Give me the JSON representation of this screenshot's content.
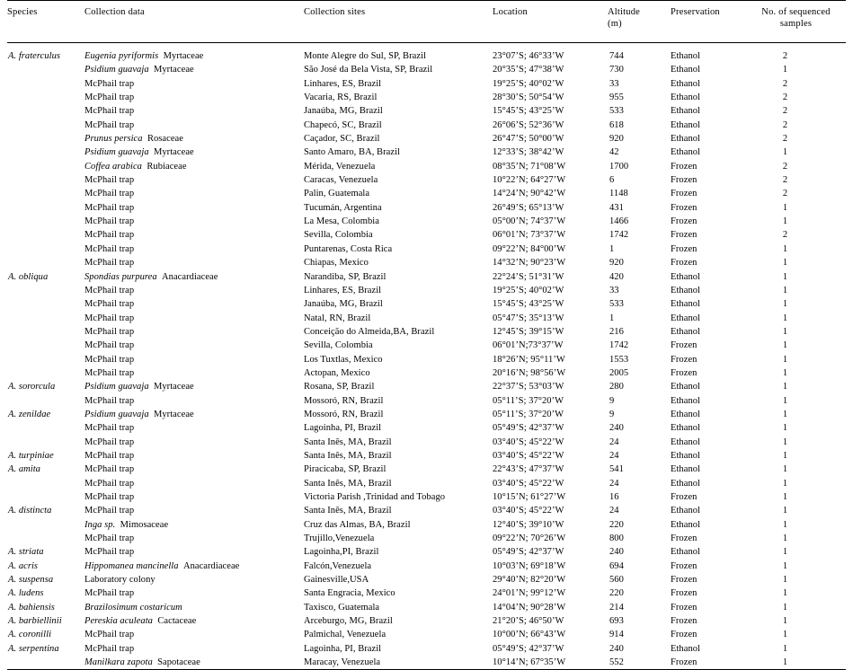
{
  "table": {
    "columns": [
      {
        "key": "species",
        "label": "Species"
      },
      {
        "key": "collection",
        "label": "Collection data"
      },
      {
        "key": "sites",
        "label": "Collection  sites"
      },
      {
        "key": "location",
        "label": "Location"
      },
      {
        "key": "altitude",
        "label": "Altitude",
        "label2": "(m)"
      },
      {
        "key": "preservation",
        "label": "Preservation"
      },
      {
        "key": "samples",
        "label": "No. of sequenced",
        "label2": "samples"
      }
    ],
    "rows": [
      {
        "species": "A. fraterculus",
        "collection_sci": "Eugenia pyriformis",
        "collection_fam": "Myrtaceae",
        "sites": "Monte Alegre do Sul, SP, Brazil",
        "location": "23°07’S; 46°33’W",
        "altitude": "744",
        "preservation": "Ethanol",
        "samples": "2"
      },
      {
        "species": "",
        "collection_sci": "Psidium guavaja",
        "collection_fam": "Myrtaceae",
        "sites": "São José da Bela Vista, SP, Brazil",
        "location": "20°35’S; 47°38’W",
        "altitude": "730",
        "preservation": "Ethanol",
        "samples": "1"
      },
      {
        "species": "",
        "collection_sci": "",
        "collection_fam": "McPhail trap",
        "sites": "Linhares, ES, Brazil",
        "location": "19°25’S; 40°02’W",
        "altitude": "33",
        "preservation": "Ethanol",
        "samples": "2"
      },
      {
        "species": "",
        "collection_sci": "",
        "collection_fam": "McPhail trap",
        "sites": "Vacaria, RS, Brazil",
        "location": "28°30’S; 50°54’W",
        "altitude": "955",
        "preservation": "Ethanol",
        "samples": "2"
      },
      {
        "species": "",
        "collection_sci": "",
        "collection_fam": "McPhail trap",
        "sites": "Janaúba, MG, Brazil",
        "location": "15°45’S; 43°25’W",
        "altitude": "533",
        "preservation": "Ethanol",
        "samples": "2"
      },
      {
        "species": "",
        "collection_sci": "",
        "collection_fam": "McPhail trap",
        "sites": "Chapecó, SC, Brazil",
        "location": "26°06’S; 52°36’W",
        "altitude": "618",
        "preservation": "Ethanol",
        "samples": "2"
      },
      {
        "species": "",
        "collection_sci": "Prunus persica",
        "collection_fam": "Rosaceae",
        "sites": "Caçador, SC, Brazil",
        "location": "26°47’S; 50°00’W",
        "altitude": "920",
        "preservation": "Ethanol",
        "samples": "2"
      },
      {
        "species": "",
        "collection_sci": "Psidium guavaja",
        "collection_fam": "Myrtaceae",
        "sites": "Santo Amaro, BA, Brazil",
        "location": "12°33’S; 38°42’W",
        "altitude": "42",
        "preservation": "Ethanol",
        "samples": "1"
      },
      {
        "species": "",
        "collection_sci": "Coffea arabica",
        "collection_fam": "Rubiaceae",
        "sites": "Mérida, Venezuela",
        "location": "08°35’N; 71°08’W",
        "altitude": "1700",
        "preservation": "Frozen",
        "samples": "2"
      },
      {
        "species": "",
        "collection_sci": "",
        "collection_fam": "McPhail trap",
        "sites": "Caracas, Venezuela",
        "location": "10°22’N; 64°27’W",
        "altitude": "6",
        "preservation": "Frozen",
        "samples": "2"
      },
      {
        "species": "",
        "collection_sci": "",
        "collection_fam": "McPhail trap",
        "sites": "Palin, Guatemala",
        "location": "14°24’N; 90°42’W",
        "altitude": "1148",
        "preservation": "Frozen",
        "samples": "2"
      },
      {
        "species": "",
        "collection_sci": "",
        "collection_fam": "McPhail trap",
        "sites": "Tucumán, Argentina",
        "location": "26°49’S; 65°13’W",
        "altitude": "431",
        "preservation": "Frozen",
        "samples": "1"
      },
      {
        "species": "",
        "collection_sci": "",
        "collection_fam": "McPhail trap",
        "sites": "La Mesa, Colombia",
        "location": "05°00’N; 74°37’W",
        "altitude": "1466",
        "preservation": "Frozen",
        "samples": "1"
      },
      {
        "species": "",
        "collection_sci": "",
        "collection_fam": "McPhail trap",
        "sites": "Sevilla, Colombia",
        "location": "06°01’N; 73°37’W",
        "altitude": "1742",
        "preservation": "Frozen",
        "samples": "2"
      },
      {
        "species": "",
        "collection_sci": "",
        "collection_fam": "McPhail trap",
        "sites": "Puntarenas, Costa Rica",
        "location": "09°22’N; 84°00’W",
        "altitude": "1",
        "preservation": "Frozen",
        "samples": "1"
      },
      {
        "species": "",
        "collection_sci": "",
        "collection_fam": "McPhail trap",
        "sites": "Chiapas, Mexico",
        "location": "14°32’N; 90°23’W",
        "altitude": "920",
        "preservation": "Frozen",
        "samples": "1"
      },
      {
        "species": "A. obliqua",
        "collection_sci": "Spondias purpurea",
        "collection_fam": "Anacardiaceae",
        "sites": "Narandiba, SP, Brazil",
        "location": "22°24’S; 51°31’W",
        "altitude": "420",
        "preservation": "Ethanol",
        "samples": "1"
      },
      {
        "species": "",
        "collection_sci": "",
        "collection_fam": "McPhail trap",
        "sites": "Linhares, ES, Brazil",
        "location": "19°25’S; 40°02’W",
        "altitude": "33",
        "preservation": "Ethanol",
        "samples": "1"
      },
      {
        "species": "",
        "collection_sci": "",
        "collection_fam": "McPhail trap",
        "sites": "Janaúba, MG, Brazil",
        "location": "15°45’S; 43°25’W",
        "altitude": "533",
        "preservation": "Ethanol",
        "samples": "1"
      },
      {
        "species": "",
        "collection_sci": "",
        "collection_fam": "McPhail trap",
        "sites": "Natal, RN, Brazil",
        "location": "05°47’S; 35°13’W",
        "altitude": "1",
        "preservation": "Ethanol",
        "samples": "1"
      },
      {
        "species": "",
        "collection_sci": "",
        "collection_fam": "McPhail trap",
        "sites": "Conceição do Almeida,BA, Brazil",
        "location": "12°45’S; 39°15’W",
        "altitude": "216",
        "preservation": "Ethanol",
        "samples": "1"
      },
      {
        "species": "",
        "collection_sci": "",
        "collection_fam": "McPhail trap",
        "sites": "Sevilla, Colombia",
        "location": "06°01’N;73°37’W",
        "altitude": "1742",
        "preservation": "Frozen",
        "samples": "1"
      },
      {
        "species": "",
        "collection_sci": "",
        "collection_fam": "McPhail trap",
        "sites": "Los Tuxtlas, Mexico",
        "location": "18°26’N; 95°11’W",
        "altitude": "1553",
        "preservation": "Frozen",
        "samples": "1"
      },
      {
        "species": "",
        "collection_sci": "",
        "collection_fam": "McPhail trap",
        "sites": "Actopan, Mexico",
        "location": "20°16’N; 98°56’W",
        "altitude": "2005",
        "preservation": "Frozen",
        "samples": "1"
      },
      {
        "species": "A. sororcula",
        "collection_sci": "Psidium guavaja",
        "collection_fam": "Myrtaceae",
        "sites": "Rosana, SP, Brazil",
        "location": "22°37’S; 53°03’W",
        "altitude": "280",
        "preservation": "Ethanol",
        "samples": "1"
      },
      {
        "species": "",
        "collection_sci": "",
        "collection_fam": "McPhail trap",
        "sites": "Mossoró, RN, Brazil",
        "location": "05°11’S; 37°20’W",
        "altitude": "9",
        "preservation": "Ethanol",
        "samples": "1"
      },
      {
        "species": "A. zenildae",
        "collection_sci": "Psidium guavaja",
        "collection_fam": "Myrtaceae",
        "sites": "Mossoró, RN, Brazil",
        "location": "05°11’S; 37°20’W",
        "altitude": "9",
        "preservation": "Ethanol",
        "samples": "1"
      },
      {
        "species": "",
        "collection_sci": "",
        "collection_fam": "McPhail trap",
        "sites": "Lagoinha, PI, Brazil",
        "location": "05°49’S; 42°37’W",
        "altitude": "240",
        "preservation": "Ethanol",
        "samples": "1"
      },
      {
        "species": "",
        "collection_sci": "",
        "collection_fam": "McPhail trap",
        "sites": "Santa Inês, MA, Brazil",
        "location": "03°40’S; 45°22’W",
        "altitude": "24",
        "preservation": "Ethanol",
        "samples": "1"
      },
      {
        "species": "A. turpiniae",
        "collection_sci": "",
        "collection_fam": "McPhail trap",
        "sites": "Santa Inês, MA, Brazil",
        "location": "03°40’S; 45°22’W",
        "altitude": "24",
        "preservation": "Ethanol",
        "samples": "1"
      },
      {
        "species": "A. amita",
        "collection_sci": "",
        "collection_fam": "McPhail trap",
        "sites": "Piracicaba, SP, Brazil",
        "location": "22°43’S; 47°37’W",
        "altitude": "541",
        "preservation": "Ethanol",
        "samples": "1"
      },
      {
        "species": "",
        "collection_sci": "",
        "collection_fam": "McPhail trap",
        "sites": "Santa Inês, MA, Brazil",
        "location": "03°40’S; 45°22’W",
        "altitude": "24",
        "preservation": "Ethanol",
        "samples": "1"
      },
      {
        "species": "",
        "collection_sci": "",
        "collection_fam": "McPhail trap",
        "sites": "Victoria Parish ,Trinidad and Tobago",
        "location": "10°15’N; 61°27’W",
        "altitude": "16",
        "preservation": "Frozen",
        "samples": "1"
      },
      {
        "species": "A. distincta",
        "collection_sci": "",
        "collection_fam": "McPhail trap",
        "sites": "Santa Inês, MA, Brazil",
        "location": "03°40’S; 45°22’W",
        "altitude": "24",
        "preservation": "Ethanol",
        "samples": "1"
      },
      {
        "species": "",
        "collection_sci": "Inga sp.",
        "collection_fam": "Mimosaceae",
        "sites": "Cruz das Almas, BA, Brazil",
        "location": "12°40’S; 39°10’W",
        "altitude": "220",
        "preservation": "Ethanol",
        "samples": "1"
      },
      {
        "species": "",
        "collection_sci": "",
        "collection_fam": "McPhail trap",
        "sites": "Trujillo,Venezuela",
        "location": "09°22’N; 70°26’W",
        "altitude": "800",
        "preservation": "Frozen",
        "samples": "1"
      },
      {
        "species": "A. striata",
        "collection_sci": "",
        "collection_fam": "McPhail trap",
        "sites": "Lagoinha,PI, Brazil",
        "location": "05°49’S; 42°37’W",
        "altitude": "240",
        "preservation": "Ethanol",
        "samples": "1"
      },
      {
        "species": "A. acris",
        "collection_sci": "Hippomanea mancinella",
        "collection_fam": "Anacardiaceae",
        "sites": "Falcón,Venezuela",
        "location": "10°03’N; 69°18’W",
        "altitude": "694",
        "preservation": "Frozen",
        "samples": "1"
      },
      {
        "species": "A. suspensa",
        "collection_sci": "",
        "collection_fam": "Laboratory colony",
        "sites": "Gainesville,USA",
        "location": "29°40’N; 82°20’W",
        "altitude": "560",
        "preservation": "Frozen",
        "samples": "1"
      },
      {
        "species": "A. ludens",
        "collection_sci": "",
        "collection_fam": "McPhail trap",
        "sites": "Santa Engracia, Mexico",
        "location": "24°01’N; 99°12’W",
        "altitude": "220",
        "preservation": "Frozen",
        "samples": "1"
      },
      {
        "species": "A. bahiensis",
        "collection_sci": "Brazilosimum costaricum",
        "collection_fam": "",
        "sites": "Taxisco, Guatemala",
        "location": "14°04’N; 90°28’W",
        "altitude": "214",
        "preservation": "Frozen",
        "samples": "1"
      },
      {
        "species": "A. barbiellinii",
        "collection_sci": "Pereskia aculeata",
        "collection_fam": "Cactaceae",
        "sites": "Arceburgo, MG, Brazil",
        "location": "21°20’S; 46°50’W",
        "altitude": "693",
        "preservation": "Frozen",
        "samples": "1"
      },
      {
        "species": "A. coronilli",
        "collection_sci": "",
        "collection_fam": "McPhail trap",
        "sites": "Palmichal, Venezuela",
        "location": "10°00’N; 66°43’W",
        "altitude": "914",
        "preservation": "Frozen",
        "samples": "1"
      },
      {
        "species": "A. serpentina",
        "collection_sci": "",
        "collection_fam": "McPhail trap",
        "sites": "Lagoinha, PI, Brazil",
        "location": "05°49’S; 42°37’W",
        "altitude": "240",
        "preservation": "Ethanol",
        "samples": "1"
      },
      {
        "species": "",
        "collection_sci": "Manilkara zapota",
        "collection_fam": "Sapotaceae",
        "sites": "Maracay, Venezuela",
        "location": "10°14’N; 67°35’W",
        "altitude": "552",
        "preservation": "Frozen",
        "samples": "1"
      }
    ]
  }
}
